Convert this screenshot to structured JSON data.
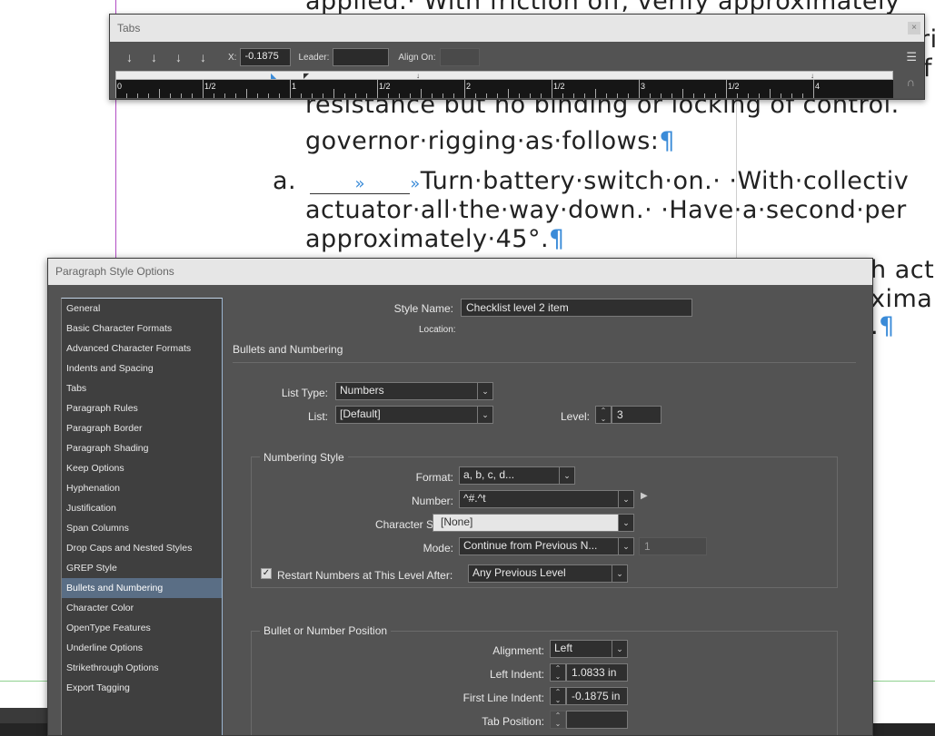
{
  "document": {
    "lines": [
      {
        "text": "applied.· With friction off, verify approximately"
      },
      {
        "text": "resistance but no binding or locking of control."
      },
      {
        "text": "governor·rigging·as·follows:",
        "pilcrow": "¶"
      },
      {
        "marker": "a.",
        "tab_glyph": "»",
        "text": "Turn·battery·switch·on.· ·With·collectiv"
      },
      {
        "text": "actuator·all·the·way·down.· ·Have·a·second·per"
      },
      {
        "text": "approximately·45°.",
        "pilcrow": "¶"
      },
      {
        "text": "h act"
      },
      {
        "text": "xima"
      },
      {
        "text": ".",
        "pilcrow": "¶"
      },
      {
        "text": "ri"
      },
      {
        "text": "f"
      }
    ]
  },
  "tabs_panel": {
    "title": "Tabs",
    "close_glyph": "×",
    "tab_align_buttons": [
      "↓",
      "↓",
      "↓",
      "↓"
    ],
    "x_label": "X:",
    "x_value": "-0.1875",
    "leader_label": "Leader:",
    "leader_value": "",
    "align_on_label": "Align On:",
    "align_on_value": "",
    "menu_glyph": "☰",
    "magnet_glyph": "∩",
    "ruler_labels": [
      "0",
      "1/2",
      "1",
      "1/2",
      "2",
      "1/2",
      "3",
      "1/2",
      "4"
    ]
  },
  "dialog": {
    "title": "Paragraph Style Options",
    "categories": [
      "General",
      "Basic Character Formats",
      "Advanced Character Formats",
      "Indents and Spacing",
      "Tabs",
      "Paragraph Rules",
      "Paragraph Border",
      "Paragraph Shading",
      "Keep Options",
      "Hyphenation",
      "Justification",
      "Span Columns",
      "Drop Caps and Nested Styles",
      "GREP Style",
      "Bullets and Numbering",
      "Character Color",
      "OpenType Features",
      "Underline Options",
      "Strikethrough Options",
      "Export Tagging"
    ],
    "selected_category": "Bullets and Numbering",
    "style_name_label": "Style Name:",
    "style_name_value": "Checklist level 2 item",
    "location_label": "Location:",
    "section_title": "Bullets and Numbering",
    "list_type_label": "List Type:",
    "list_type_value": "Numbers",
    "list_label": "List:",
    "list_value": "[Default]",
    "level_label": "Level:",
    "level_value": "3",
    "numbering_style": {
      "title": "Numbering Style",
      "format_label": "Format:",
      "format_value": "a, b, c, d...",
      "number_label": "Number:",
      "number_value": "^#.^t",
      "char_style_label": "Character Style:",
      "char_style_value": "[None]",
      "mode_label": "Mode:",
      "mode_value": "Continue from Previous N...",
      "mode_start_value": "1",
      "restart_checked": true,
      "restart_label": "Restart Numbers at This Level After:",
      "restart_value": "Any Previous Level"
    },
    "position": {
      "title": "Bullet or Number Position",
      "alignment_label": "Alignment:",
      "alignment_value": "Left",
      "left_indent_label": "Left Indent:",
      "left_indent_value": "1.0833 in",
      "first_line_label": "First Line Indent:",
      "first_line_value": "-0.1875 in",
      "tab_position_label": "Tab Position:",
      "tab_position_value": ""
    }
  }
}
